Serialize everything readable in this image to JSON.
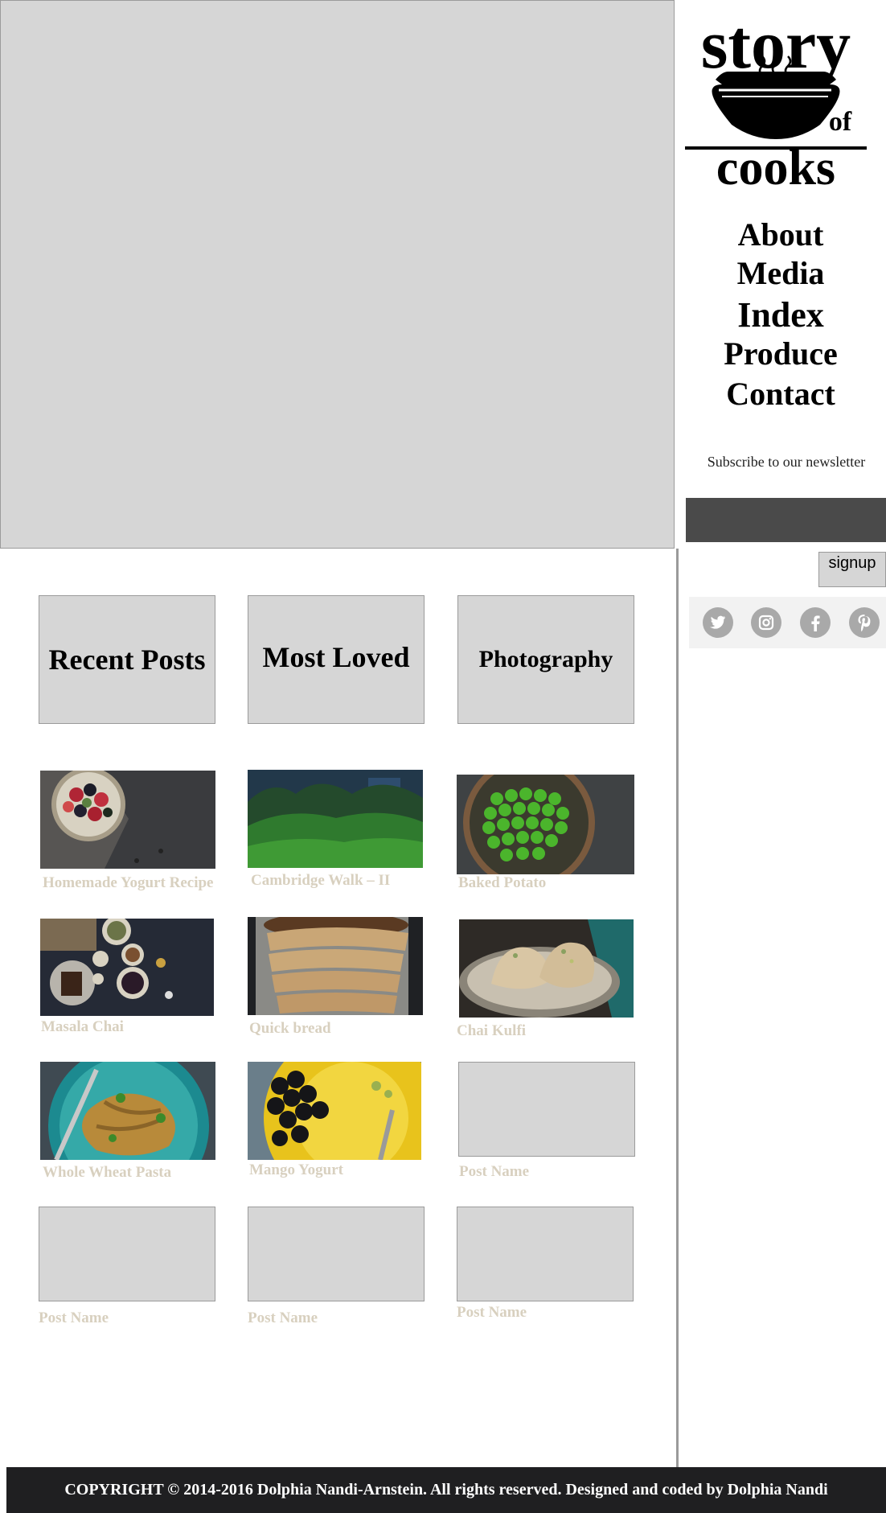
{
  "brand": {
    "logo_lines": [
      "story",
      "of",
      "cooks"
    ]
  },
  "nav": [
    "About",
    "Media",
    "Index",
    "Produce",
    "Contact"
  ],
  "newsletter": {
    "heading": "Subscribe to our newsletter",
    "input_value": "",
    "button_label": "signup"
  },
  "social": [
    "twitter-icon",
    "instagram-icon",
    "facebook-icon",
    "pinterest-icon"
  ],
  "tabs": [
    "Recent Posts",
    "Most Loved",
    "Photography"
  ],
  "posts": [
    {
      "title": "Homemade Yogurt Recipe",
      "image": "berries-bowl"
    },
    {
      "title": "Cambridge Walk – II",
      "image": "garden-path"
    },
    {
      "title": "Baked Potato",
      "image": "green-peas"
    },
    {
      "title": "Masala Chai",
      "image": "chai-spices"
    },
    {
      "title": "Quick bread",
      "image": "sliced-bread"
    },
    {
      "title": "Chai Kulfi",
      "image": "kulfi-plate"
    },
    {
      "title": "Whole Wheat Pasta",
      "image": "pasta-plate"
    },
    {
      "title": "Mango Yogurt",
      "image": "mango-yogurt"
    },
    {
      "title": "Post Name",
      "image": "placeholder"
    },
    {
      "title": "Post Name",
      "image": "placeholder"
    },
    {
      "title": "Post Name",
      "image": "placeholder"
    },
    {
      "title": "Post Name",
      "image": "placeholder"
    }
  ],
  "footer": {
    "text": "COPYRIGHT © 2014-2016 Dolphia Nandi-Arnstein. All rights reserved. Designed and coded by Dolphia Nandi"
  },
  "colors": {
    "placeholder": "#d6d6d6",
    "caption": "#d8d0bf",
    "footer_bg": "#1f1f21",
    "input_bg": "#4a4a4a",
    "social": "#a9a9a9"
  }
}
